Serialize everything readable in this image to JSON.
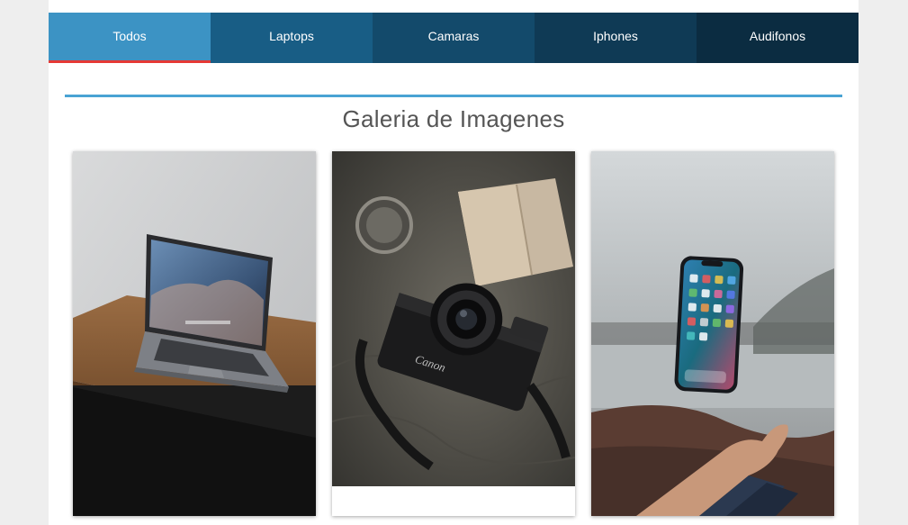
{
  "tabs": [
    {
      "label": "Todos",
      "active": true
    },
    {
      "label": "Laptops",
      "active": false
    },
    {
      "label": "Camaras",
      "active": false
    },
    {
      "label": "Iphones",
      "active": false
    },
    {
      "label": "Audifonos",
      "active": false
    }
  ],
  "gallery": {
    "title": "Galeria de Imagenes",
    "images": [
      {
        "subject": "laptop on wooden table"
      },
      {
        "subject": "Canon camera on map"
      },
      {
        "subject": "iPhone floating above hand"
      }
    ],
    "camera_brand_text": "Canon"
  },
  "colors": {
    "accent_blue": "#4aa3d4",
    "active_underline": "#e53935"
  }
}
